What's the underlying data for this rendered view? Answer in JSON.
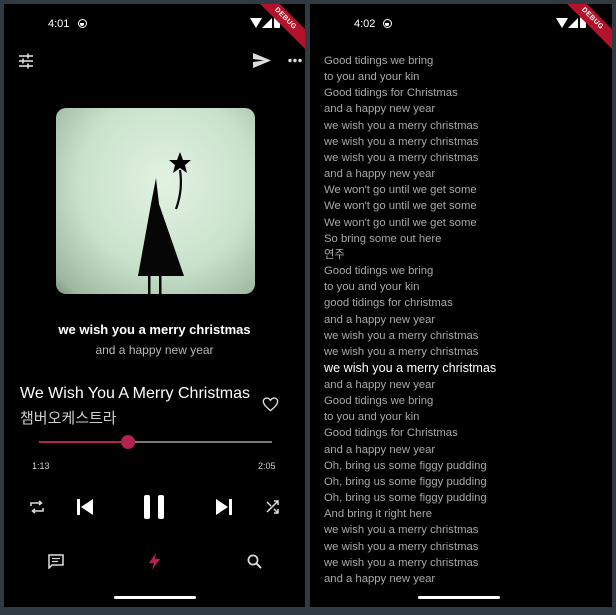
{
  "player_screen": {
    "status_time": "4:01",
    "debug_banner": "DEBUG",
    "current_lyric": "we wish you a merry christmas",
    "next_lyric": "and a happy new year",
    "song_title": "We Wish You A Merry Christmas",
    "artist": "챔버오케스트라",
    "elapsed": "1:13",
    "duration": "2:05",
    "progress": 0.38,
    "accent_color": "#b3234d",
    "icons": {
      "top_left": "equalizer-icon",
      "top_share": "send-icon",
      "top_menu": "more-horizontal-icon",
      "favorite": "heart-outline-icon",
      "repeat": "repeat-icon",
      "previous": "skip-previous-icon",
      "play_pause": "pause-icon",
      "next": "skip-next-icon",
      "shuffle": "shuffle-icon",
      "nav_lyrics": "chat-icon",
      "nav_player": "lightning-icon",
      "nav_search": "search-icon"
    }
  },
  "lyrics_screen": {
    "status_time": "4:02",
    "debug_banner": "DEBUG",
    "lines": [
      "Good tidings we bring",
      "to you and your kin",
      "Good tidings for Christmas",
      "and a happy new year",
      "we wish you a merry christmas",
      "we wish you a merry christmas",
      "we wish you a merry christmas",
      "and a happy new year",
      "We won't go until we get some",
      "We won't go until we get some",
      "We won't go until we get some",
      "So bring some out here",
      "연주",
      "Good tidings we bring",
      "to you and your kin",
      "good tidings for christmas",
      "and a happy new year",
      "we wish you a merry christmas",
      "we wish you a merry christmas",
      "we wish you a merry christmas",
      "and a happy new year",
      "Good tidings we bring",
      "to you and your kin",
      "Good tidings for Christmas",
      "and a happy new year",
      "Oh, bring us some figgy pudding",
      "Oh, bring us some figgy pudding",
      "Oh, bring us some figgy pudding",
      "And bring it right here",
      "we wish you a merry christmas",
      "we wish you a merry christmas",
      "we wish you a merry christmas",
      "and a happy new year"
    ],
    "active_index": 19
  }
}
